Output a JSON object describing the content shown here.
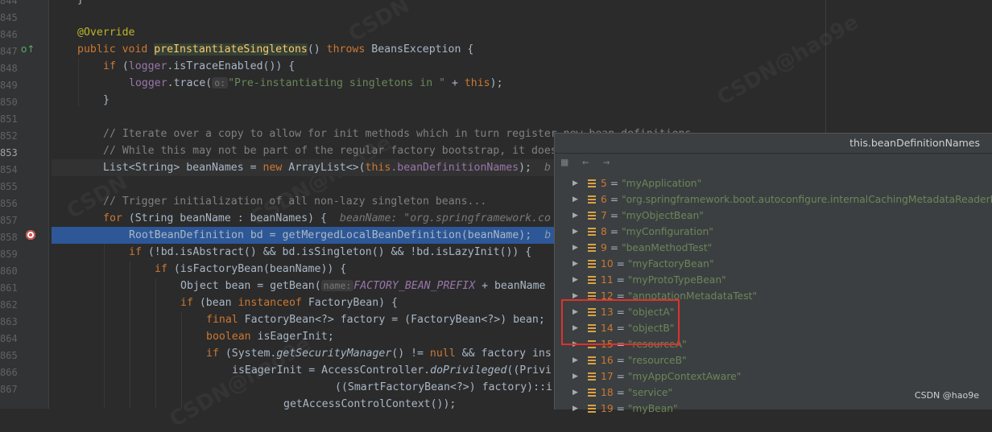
{
  "editor": {
    "line_numbers": [
      "844",
      "845",
      "846",
      "847",
      "848",
      "849",
      "850",
      "851",
      "852",
      "853",
      "854",
      "855",
      "856",
      "857",
      "858",
      "859",
      "860",
      "861",
      "862",
      "863",
      "864",
      "865",
      "866",
      "867"
    ]
  },
  "code": {
    "l844": "}",
    "l845_ann": "@Override",
    "l846_kw1": "public void ",
    "l846_fn": "preInstantiateSingletons",
    "l846_mid": "() ",
    "l846_kw2": "throws ",
    "l846_rest": "BeansException {",
    "l847_kw": "if ",
    "l847_p1": "(",
    "l847_fld": "logger",
    "l847_rest": ".isTraceEnabled()) {",
    "l848_fld": "logger",
    "l848_mid": ".trace(",
    "l848_hint": "o:",
    "l848_str": "\"Pre-instantiating singletons in \"",
    "l848_plus": " + ",
    "l848_this": "this",
    "l848_end": ");",
    "l849": "}",
    "l851": "// Iterate over a copy to allow for init methods which in turn register new bean definitions.",
    "l852": "// While this may not be part of the regular factory bootstrap, it does otherwise work fine.",
    "l853_a": "List<String> beanNames = ",
    "l853_new": "new ",
    "l853_b": "ArrayList<>(",
    "l853_this": "this",
    "l853_fld": ".beanDefinitionNames",
    "l853_c": ");",
    "l853_inlay": "b",
    "l855": "// Trigger initialization of all non-lazy singleton beans...",
    "l856_kw": "for ",
    "l856_a": "(String beanName : beanNames) {",
    "l856_inlay": "beanName: \"org.springframework.co",
    "l857_a": "RootBeanDefinition bd = getMergedLocalBeanDefinition(beanName);",
    "l857_inlay": "b",
    "l858_kw": "if ",
    "l858_a": "(!bd.isAbstract() && bd.isSingleton() && !bd.isLazyInit()) {",
    "l859_kw": "if ",
    "l859_a": "(isFactoryBean(beanName)) {",
    "l860_a": "Object bean = getBean(",
    "l860_hint": "name:",
    "l860_const": "FACTORY_BEAN_PREFIX",
    "l860_b": " + beanName",
    "l861_kw": "if ",
    "l861_a": "(bean ",
    "l861_kw2": "instanceof ",
    "l861_b": "FactoryBean) {",
    "l862_kw": "final ",
    "l862_a": "FactoryBean<?> factory = (FactoryBean<?>) bean;",
    "l863_kw": "boolean ",
    "l863_a": "isEagerInit;",
    "l864_kw": "if ",
    "l864_a": "(System.",
    "l864_st": "getSecurityManager",
    "l864_b": "() != ",
    "l864_null": "null ",
    "l864_c": "&& factory ins",
    "l865_a": "isEagerInit = AccessController.",
    "l865_st": "doPrivileged",
    "l865_b": "((Privi",
    "l866_a": "((SmartFactoryBean<?>) factory)::i",
    "l867_a": "getAccessControlContext());"
  },
  "popup": {
    "title": "this.beanDefinitionNames",
    "items": [
      {
        "idx": "5",
        "val": "\"myApplication\""
      },
      {
        "idx": "6",
        "val": "\"org.springframework.boot.autoconfigure.internalCachingMetadataReaderFacto"
      },
      {
        "idx": "7",
        "val": "\"myObjectBean\""
      },
      {
        "idx": "8",
        "val": "\"myConfiguration\""
      },
      {
        "idx": "9",
        "val": "\"beanMethodTest\""
      },
      {
        "idx": "10",
        "val": "\"myFactoryBean\""
      },
      {
        "idx": "11",
        "val": "\"myProtoTypeBean\""
      },
      {
        "idx": "12",
        "val": "\"annotationMetadataTest\""
      },
      {
        "idx": "13",
        "val": "\"objectA\""
      },
      {
        "idx": "14",
        "val": "\"objectB\""
      },
      {
        "idx": "15",
        "val": "\"resourceA\""
      },
      {
        "idx": "16",
        "val": "\"resourceB\""
      },
      {
        "idx": "17",
        "val": "\"myAppContextAware\""
      },
      {
        "idx": "18",
        "val": "\"service\""
      },
      {
        "idx": "19",
        "val": "\"myBean\""
      }
    ],
    "eq": " = "
  },
  "watermark": "CSDN @hao9e",
  "colors": {
    "accent_selection": "#2d5796",
    "highlight_box": "#e0312b",
    "editor_bg": "#2b2b2b"
  }
}
